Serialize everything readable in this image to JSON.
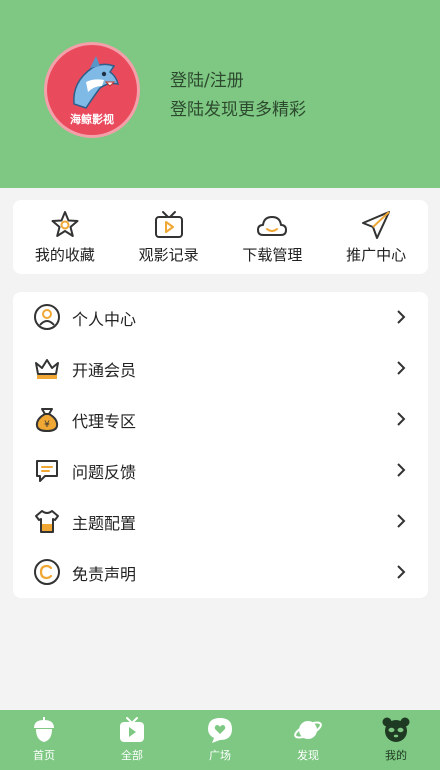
{
  "profile": {
    "avatar_text": "海鲸影视",
    "login_title": "登陆/注册",
    "login_subtitle": "登陆发现更多精彩"
  },
  "quick_actions": [
    {
      "label": "我的收藏",
      "icon": "star-icon"
    },
    {
      "label": "观影记录",
      "icon": "tv-play-icon"
    },
    {
      "label": "下载管理",
      "icon": "cloud-icon"
    },
    {
      "label": "推广中心",
      "icon": "paper-plane-icon"
    }
  ],
  "menu": [
    {
      "label": "个人中心",
      "icon": "user-circle-icon"
    },
    {
      "label": "开通会员",
      "icon": "crown-icon"
    },
    {
      "label": "代理专区",
      "icon": "money-bag-icon"
    },
    {
      "label": "问题反馈",
      "icon": "chat-icon"
    },
    {
      "label": "主题配置",
      "icon": "shirt-icon"
    },
    {
      "label": "免责声明",
      "icon": "copyright-icon"
    }
  ],
  "tabbar": [
    {
      "label": "首页",
      "icon": "acorn-icon"
    },
    {
      "label": "全部",
      "icon": "play-tv-icon"
    },
    {
      "label": "广场",
      "icon": "heart-bubble-icon"
    },
    {
      "label": "发现",
      "icon": "planet-icon"
    },
    {
      "label": "我的",
      "icon": "panda-icon",
      "active": true
    }
  ],
  "colors": {
    "header_bg": "#7ec883",
    "accent_orange": "#f0a733",
    "avatar_bg": "#e94a5c"
  }
}
